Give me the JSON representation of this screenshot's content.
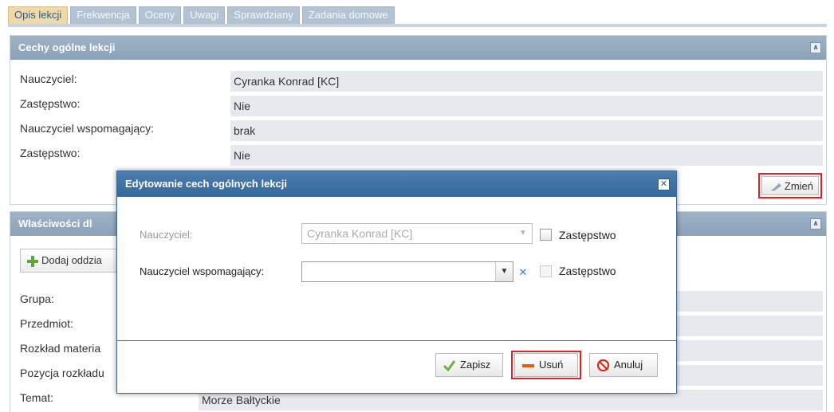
{
  "tabs": [
    {
      "label": "Opis lekcji",
      "active": true
    },
    {
      "label": "Frekwencja"
    },
    {
      "label": "Oceny"
    },
    {
      "label": "Uwagi"
    },
    {
      "label": "Sprawdziany"
    },
    {
      "label": "Zadania domowe"
    }
  ],
  "general": {
    "title": "Cechy ogólne lekcji",
    "rows": [
      {
        "label": "Nauczyciel:",
        "value": "Cyranka Konrad [KC]"
      },
      {
        "label": "Zastępstwo:",
        "value": "Nie"
      },
      {
        "label": "Nauczyciel wspomagający:",
        "value": "brak"
      },
      {
        "label": "Zastępstwo:",
        "value": "Nie"
      }
    ],
    "edit_label": "Zmień"
  },
  "properties": {
    "title": "Właściwości dl",
    "add_label": "Dodaj oddzia",
    "rows": [
      {
        "label": "Grupa:",
        "value": ""
      },
      {
        "label": "Przedmiot:",
        "value": ""
      },
      {
        "label": "Rozkład materia",
        "value": ""
      },
      {
        "label": "Pozycja rozkładu",
        "value": ""
      },
      {
        "label": "Temat:",
        "value": "Morze Bałtyckie"
      }
    ]
  },
  "modal": {
    "title": "Edytowanie cech ogólnych lekcji",
    "teacher_label": "Nauczyciel:",
    "teacher_value": "Cyranka Konrad [KC]",
    "substitution_label": "Zastępstwo",
    "assistant_label": "Nauczyciel wspomagający:",
    "assistant_value": "",
    "substitution2_label": "Zastępstwo",
    "save_label": "Zapisz",
    "delete_label": "Usuń",
    "cancel_label": "Anuluj"
  },
  "colors": {
    "highlight": "#e1202a",
    "modal_header": "#35689c",
    "panel_header": "#8aa1b8"
  }
}
